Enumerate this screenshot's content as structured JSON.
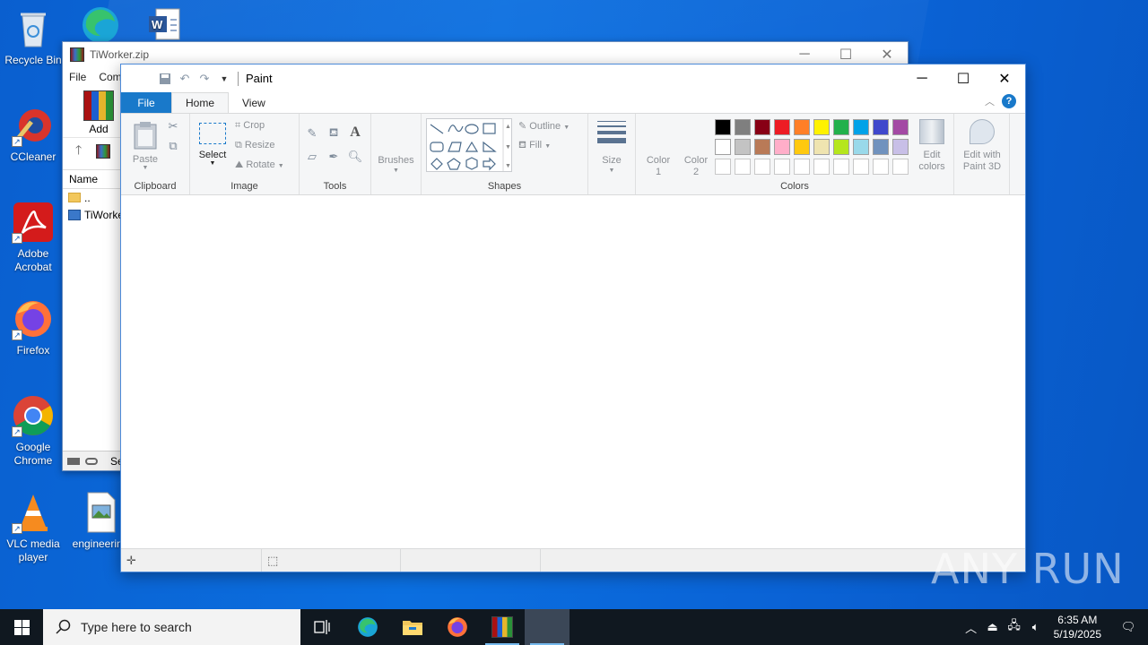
{
  "desktop": {
    "icons": [
      {
        "label": "Recycle Bin"
      },
      {
        "label": "CCleaner"
      },
      {
        "label": "Adobe Acrobat"
      },
      {
        "label": "Firefox"
      },
      {
        "label": "Google Chrome"
      },
      {
        "label": "VLC media player"
      },
      {
        "label": "engineering"
      }
    ],
    "watermark": "ANY RUN"
  },
  "winrar": {
    "title": "TiWorker.zip",
    "menu": [
      "File",
      "Com"
    ],
    "add_label": "Add",
    "column_name": "Name",
    "rows": [
      "..",
      "TiWorker"
    ],
    "status_text": "Sele"
  },
  "paint": {
    "title": "Paint",
    "tabs": [
      "File",
      "Home",
      "View"
    ],
    "clipboard": {
      "paste": "Paste",
      "label": "Clipboard"
    },
    "image": {
      "select": "Select",
      "crop": "Crop",
      "resize": "Resize",
      "rotate": "Rotate",
      "label": "Image"
    },
    "tools": {
      "label": "Tools"
    },
    "brushes": {
      "label": "Brushes"
    },
    "shapes": {
      "outline": "Outline",
      "fill": "Fill",
      "label": "Shapes"
    },
    "size": {
      "label": "Size"
    },
    "colors": {
      "color1": "Color 1",
      "color2": "Color 2",
      "edit_colors": "Edit colors",
      "edit_3d": "Edit with Paint 3D",
      "label": "Colors",
      "row1": [
        "#000000",
        "#7f7f7f",
        "#880015",
        "#ed1c24",
        "#ff7f27",
        "#fff200",
        "#22b14c",
        "#00a2e8",
        "#3f48cc",
        "#a349a4"
      ],
      "row2": [
        "#ffffff",
        "#c3c3c3",
        "#b97a57",
        "#ffaec9",
        "#ffc90e",
        "#efe4b0",
        "#b5e61d",
        "#99d9ea",
        "#7092be",
        "#c8bfe7"
      ],
      "row3": [
        "#ffffff",
        "#ffffff",
        "#ffffff",
        "#ffffff",
        "#ffffff",
        "#ffffff",
        "#ffffff",
        "#ffffff",
        "#ffffff",
        "#ffffff"
      ]
    }
  },
  "taskbar": {
    "search_placeholder": "Type here to search",
    "time": "6:35 AM",
    "date": "5/19/2025"
  }
}
